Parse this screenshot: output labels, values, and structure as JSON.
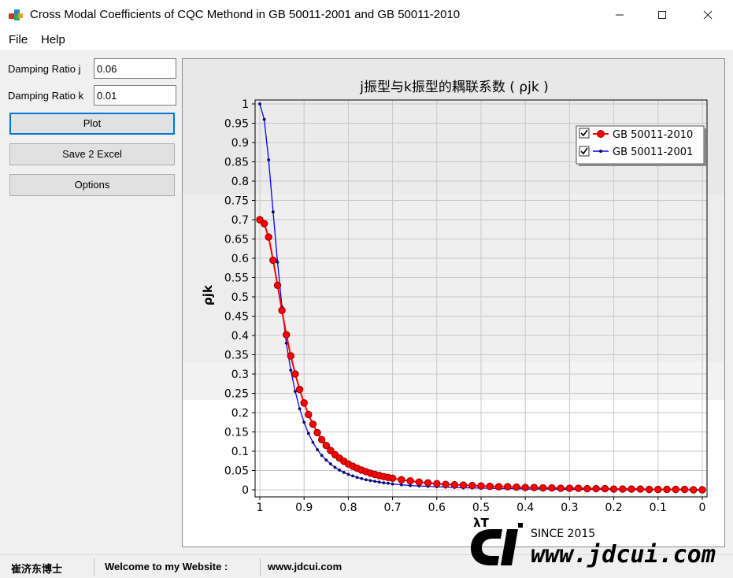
{
  "window": {
    "title": "Cross Modal Coefficients of CQC Methond in GB 50011-2001 and GB 50011-2010"
  },
  "menu": {
    "items": [
      "File",
      "Help"
    ]
  },
  "inputs": {
    "damping_j_label": "Damping Ratio j",
    "damping_j_value": "0.06",
    "damping_k_label": "Damping Ratio k",
    "damping_k_value": "0.01"
  },
  "buttons": {
    "plot": "Plot",
    "save": "Save 2 Excel",
    "options": "Options"
  },
  "status": {
    "author": "崔济东博士",
    "welcome": "Welcome to my Website :",
    "website": "www.jdcui.com"
  },
  "watermark": {
    "since": "SINCE 2015",
    "site": "www.jdcui.com"
  },
  "chart_data": {
    "type": "line",
    "title": "j振型与k振型的耦联系数 ( ρjk )",
    "xlabel": "λT",
    "ylabel": "ρjk",
    "xlim": [
      1,
      0
    ],
    "ylim": [
      0,
      1
    ],
    "xticks": [
      "1",
      "0.9",
      "0.8",
      "0.7",
      "0.6",
      "0.5",
      "0.4",
      "0.3",
      "0.2",
      "0.1",
      "0"
    ],
    "yticks": [
      "0",
      "0.05",
      "0.1",
      "0.15",
      "0.2",
      "0.25",
      "0.3",
      "0.35",
      "0.4",
      "0.45",
      "0.5",
      "0.55",
      "0.6",
      "0.65",
      "0.7",
      "0.75",
      "0.8",
      "0.85",
      "0.9",
      "0.95",
      "1"
    ],
    "grid": true,
    "legend_position": "top-right",
    "series": [
      {
        "name": "GB 50011-2010",
        "color": "#ff0000",
        "marker": "circle-large",
        "x": [
          1,
          0.99,
          0.98,
          0.97,
          0.96,
          0.95,
          0.94,
          0.93,
          0.92,
          0.91,
          0.9,
          0.89,
          0.88,
          0.87,
          0.86,
          0.85,
          0.84,
          0.83,
          0.82,
          0.81,
          0.8,
          0.79,
          0.78,
          0.77,
          0.76,
          0.75,
          0.74,
          0.73,
          0.72,
          0.71,
          0.7,
          0.68,
          0.66,
          0.64,
          0.62,
          0.6,
          0.58,
          0.56,
          0.54,
          0.52,
          0.5,
          0.48,
          0.46,
          0.44,
          0.42,
          0.4,
          0.38,
          0.36,
          0.34,
          0.32,
          0.3,
          0.28,
          0.26,
          0.24,
          0.22,
          0.2,
          0.18,
          0.16,
          0.14,
          0.12,
          0.1,
          0.08,
          0.06,
          0.04,
          0.02,
          0
        ],
        "y": [
          0.7,
          0.69,
          0.655,
          0.595,
          0.53,
          0.465,
          0.402,
          0.347,
          0.3,
          0.26,
          0.225,
          0.195,
          0.17,
          0.148,
          0.13,
          0.115,
          0.102,
          0.091,
          0.082,
          0.074,
          0.067,
          0.061,
          0.056,
          0.051,
          0.047,
          0.043,
          0.04,
          0.037,
          0.034,
          0.032,
          0.03,
          0.026,
          0.023,
          0.02,
          0.018,
          0.016,
          0.014,
          0.013,
          0.012,
          0.011,
          0.01,
          0.009,
          0.008,
          0.008,
          0.007,
          0.006,
          0.006,
          0.005,
          0.005,
          0.004,
          0.004,
          0.004,
          0.003,
          0.003,
          0.003,
          0.002,
          0.002,
          0.002,
          0.002,
          0.001,
          0.001,
          0.001,
          0.001,
          0.001,
          0.0,
          0.0
        ]
      },
      {
        "name": "GB 50011-2001",
        "color": "#0000ff",
        "marker": "dot-small",
        "x": [
          1,
          0.99,
          0.98,
          0.97,
          0.96,
          0.95,
          0.94,
          0.93,
          0.92,
          0.91,
          0.9,
          0.89,
          0.88,
          0.87,
          0.86,
          0.85,
          0.84,
          0.83,
          0.82,
          0.81,
          0.8,
          0.79,
          0.78,
          0.77,
          0.76,
          0.75,
          0.74,
          0.73,
          0.72,
          0.71,
          0.7,
          0.68,
          0.66,
          0.64,
          0.62,
          0.6,
          0.58,
          0.56,
          0.54,
          0.52,
          0.5,
          0.48,
          0.46,
          0.44,
          0.42,
          0.4,
          0.38,
          0.36,
          0.34,
          0.32,
          0.3,
          0.28,
          0.26,
          0.24,
          0.22,
          0.2,
          0.18,
          0.16,
          0.14,
          0.12,
          0.1,
          0.08,
          0.06,
          0.04,
          0.02,
          0
        ],
        "y": [
          1.0,
          0.96,
          0.855,
          0.72,
          0.59,
          0.475,
          0.38,
          0.31,
          0.255,
          0.21,
          0.175,
          0.146,
          0.123,
          0.104,
          0.089,
          0.077,
          0.067,
          0.058,
          0.051,
          0.045,
          0.04,
          0.036,
          0.032,
          0.029,
          0.026,
          0.024,
          0.022,
          0.02,
          0.018,
          0.017,
          0.015,
          0.013,
          0.011,
          0.01,
          0.009,
          0.008,
          0.007,
          0.006,
          0.005,
          0.005,
          0.004,
          0.004,
          0.003,
          0.003,
          0.003,
          0.002,
          0.002,
          0.002,
          0.002,
          0.001,
          0.001,
          0.001,
          0.001,
          0.001,
          0.001,
          0.001,
          0.0,
          0.0,
          0.0,
          0.0,
          0.0,
          0.0,
          0.0,
          0.0,
          0.0,
          0.0
        ]
      }
    ]
  }
}
